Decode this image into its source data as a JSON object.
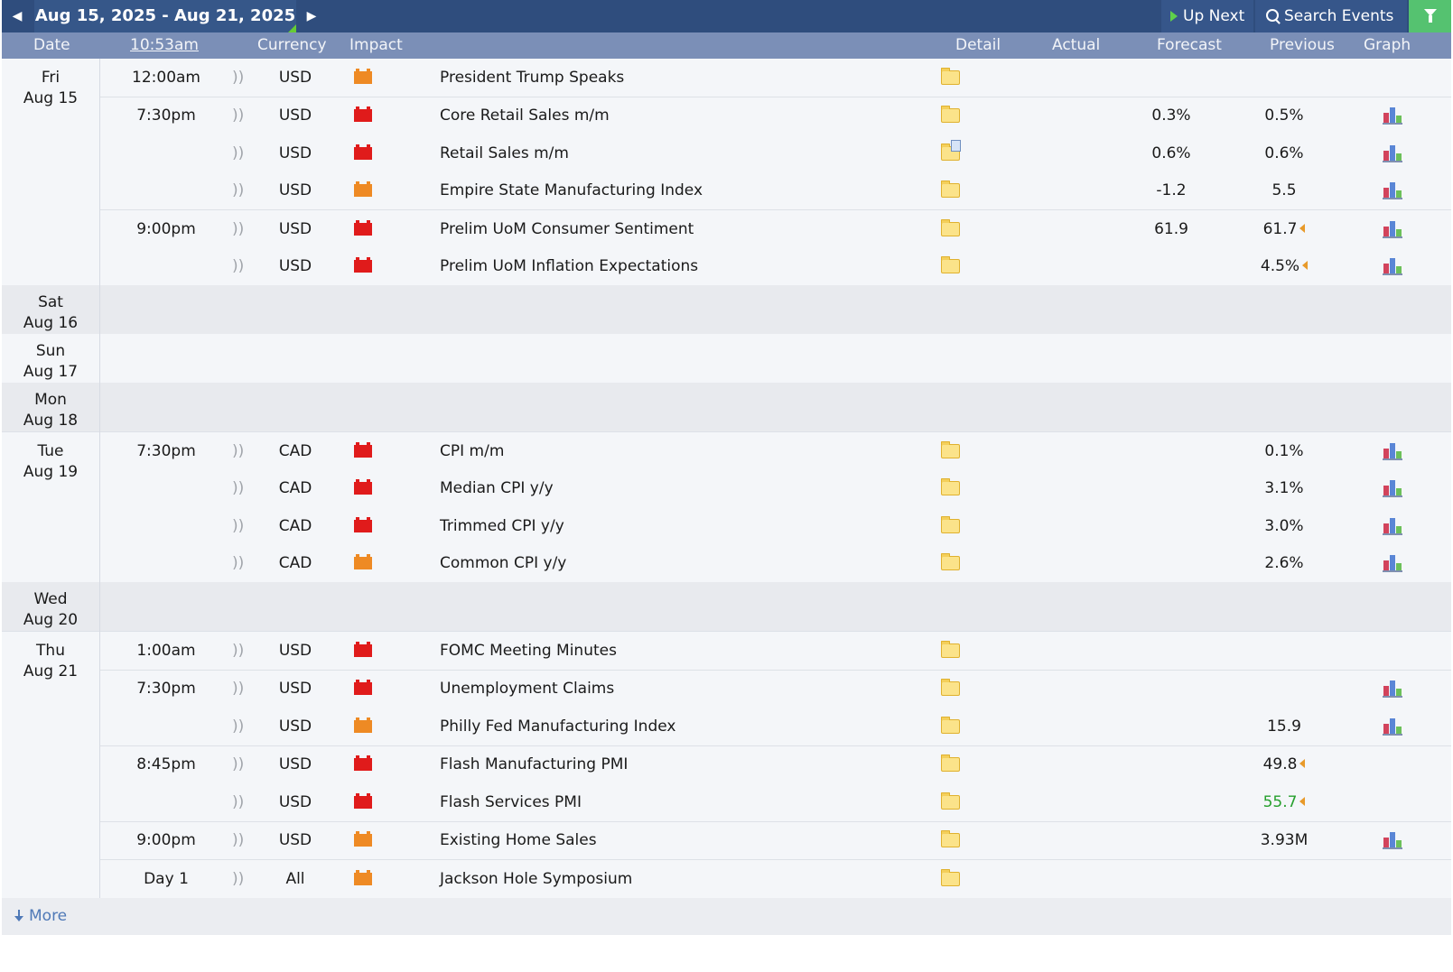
{
  "topbar": {
    "prev_icon": "caret-left-icon",
    "range_label": "Aug 15, 2025 - Aug 21, 2025",
    "next_icon": "caret-right-icon",
    "up_next_label": "Up Next",
    "search_label": "Search Events",
    "filter_icon": "funnel-icon"
  },
  "header": {
    "date": "Date",
    "time": "10:53am",
    "currency": "Currency",
    "impact": "Impact",
    "detail": "Detail",
    "actual": "Actual",
    "forecast": "Forecast",
    "previous": "Previous",
    "graph": "Graph"
  },
  "colors": {
    "topbar_bg": "#2f4d7d",
    "header_bg": "#7b8fb7",
    "high_impact": "#e01b1b",
    "medium_impact": "#ee8a24",
    "better_value": "#27a02e",
    "filter_bg": "#55c270"
  },
  "days": [
    {
      "weekday": "Fri",
      "date": "Aug 15",
      "events": [
        {
          "time": "12:00am",
          "currency": "USD",
          "impact": "medium",
          "name": "President Trump Speaks",
          "detail_icon": "folder-icon",
          "actual": "",
          "forecast": "",
          "previous": "",
          "graph": false
        },
        {
          "time": "7:30pm",
          "currency": "USD",
          "impact": "high",
          "name": "Core Retail Sales m/m",
          "detail_icon": "folder-icon",
          "actual": "",
          "forecast": "0.3%",
          "previous": "0.5%",
          "graph": true
        },
        {
          "time": "",
          "currency": "USD",
          "impact": "high",
          "name": "Retail Sales m/m",
          "detail_icon": "folder-doc-icon",
          "actual": "",
          "forecast": "0.6%",
          "previous": "0.6%",
          "graph": true
        },
        {
          "time": "",
          "currency": "USD",
          "impact": "medium",
          "name": "Empire State Manufacturing Index",
          "detail_icon": "folder-icon",
          "actual": "",
          "forecast": "-1.2",
          "previous": "5.5",
          "graph": true
        },
        {
          "time": "9:00pm",
          "currency": "USD",
          "impact": "high",
          "name": "Prelim UoM Consumer Sentiment",
          "detail_icon": "folder-icon",
          "actual": "",
          "forecast": "61.9",
          "previous": "61.7",
          "revised": true,
          "graph": true
        },
        {
          "time": "",
          "currency": "USD",
          "impact": "high",
          "name": "Prelim UoM Inflation Expectations",
          "detail_icon": "folder-icon",
          "actual": "",
          "forecast": "",
          "previous": "4.5%",
          "revised": true,
          "graph": true
        }
      ]
    },
    {
      "weekday": "Sat",
      "date": "Aug 16",
      "events": []
    },
    {
      "weekday": "Sun",
      "date": "Aug 17",
      "events": []
    },
    {
      "weekday": "Mon",
      "date": "Aug 18",
      "events": []
    },
    {
      "weekday": "Tue",
      "date": "Aug 19",
      "events": [
        {
          "time": "7:30pm",
          "currency": "CAD",
          "impact": "high",
          "name": "CPI m/m",
          "detail_icon": "folder-icon",
          "actual": "",
          "forecast": "",
          "previous": "0.1%",
          "graph": true
        },
        {
          "time": "",
          "currency": "CAD",
          "impact": "high",
          "name": "Median CPI y/y",
          "detail_icon": "folder-icon",
          "actual": "",
          "forecast": "",
          "previous": "3.1%",
          "graph": true
        },
        {
          "time": "",
          "currency": "CAD",
          "impact": "high",
          "name": "Trimmed CPI y/y",
          "detail_icon": "folder-icon",
          "actual": "",
          "forecast": "",
          "previous": "3.0%",
          "graph": true
        },
        {
          "time": "",
          "currency": "CAD",
          "impact": "medium",
          "name": "Common CPI y/y",
          "detail_icon": "folder-icon",
          "actual": "",
          "forecast": "",
          "previous": "2.6%",
          "graph": true
        }
      ]
    },
    {
      "weekday": "Wed",
      "date": "Aug 20",
      "events": []
    },
    {
      "weekday": "Thu",
      "date": "Aug 21",
      "events": [
        {
          "time": "1:00am",
          "currency": "USD",
          "impact": "high",
          "name": "FOMC Meeting Minutes",
          "detail_icon": "folder-icon",
          "actual": "",
          "forecast": "",
          "previous": "",
          "graph": false
        },
        {
          "time": "7:30pm",
          "currency": "USD",
          "impact": "high",
          "name": "Unemployment Claims",
          "detail_icon": "folder-icon",
          "actual": "",
          "forecast": "",
          "previous": "",
          "graph": true
        },
        {
          "time": "",
          "currency": "USD",
          "impact": "medium",
          "name": "Philly Fed Manufacturing Index",
          "detail_icon": "folder-icon",
          "actual": "",
          "forecast": "",
          "previous": "15.9",
          "graph": true
        },
        {
          "time": "8:45pm",
          "currency": "USD",
          "impact": "high",
          "name": "Flash Manufacturing PMI",
          "detail_icon": "folder-icon",
          "actual": "",
          "forecast": "",
          "previous": "49.8",
          "revised": true,
          "graph": false
        },
        {
          "time": "",
          "currency": "USD",
          "impact": "high",
          "name": "Flash Services PMI",
          "detail_icon": "folder-icon",
          "actual": "",
          "forecast": "",
          "previous": "55.7",
          "revised": true,
          "better": true,
          "graph": false
        },
        {
          "time": "9:00pm",
          "currency": "USD",
          "impact": "medium",
          "name": "Existing Home Sales",
          "detail_icon": "folder-icon",
          "actual": "",
          "forecast": "",
          "previous": "3.93M",
          "graph": true
        },
        {
          "time": "Day 1",
          "currency": "All",
          "impact": "medium",
          "name": "Jackson Hole Symposium",
          "detail_icon": "folder-icon",
          "actual": "",
          "forecast": "",
          "previous": "",
          "graph": false
        }
      ]
    }
  ],
  "footer": {
    "more_label": "More",
    "more_icon": "download-arrow-icon"
  }
}
